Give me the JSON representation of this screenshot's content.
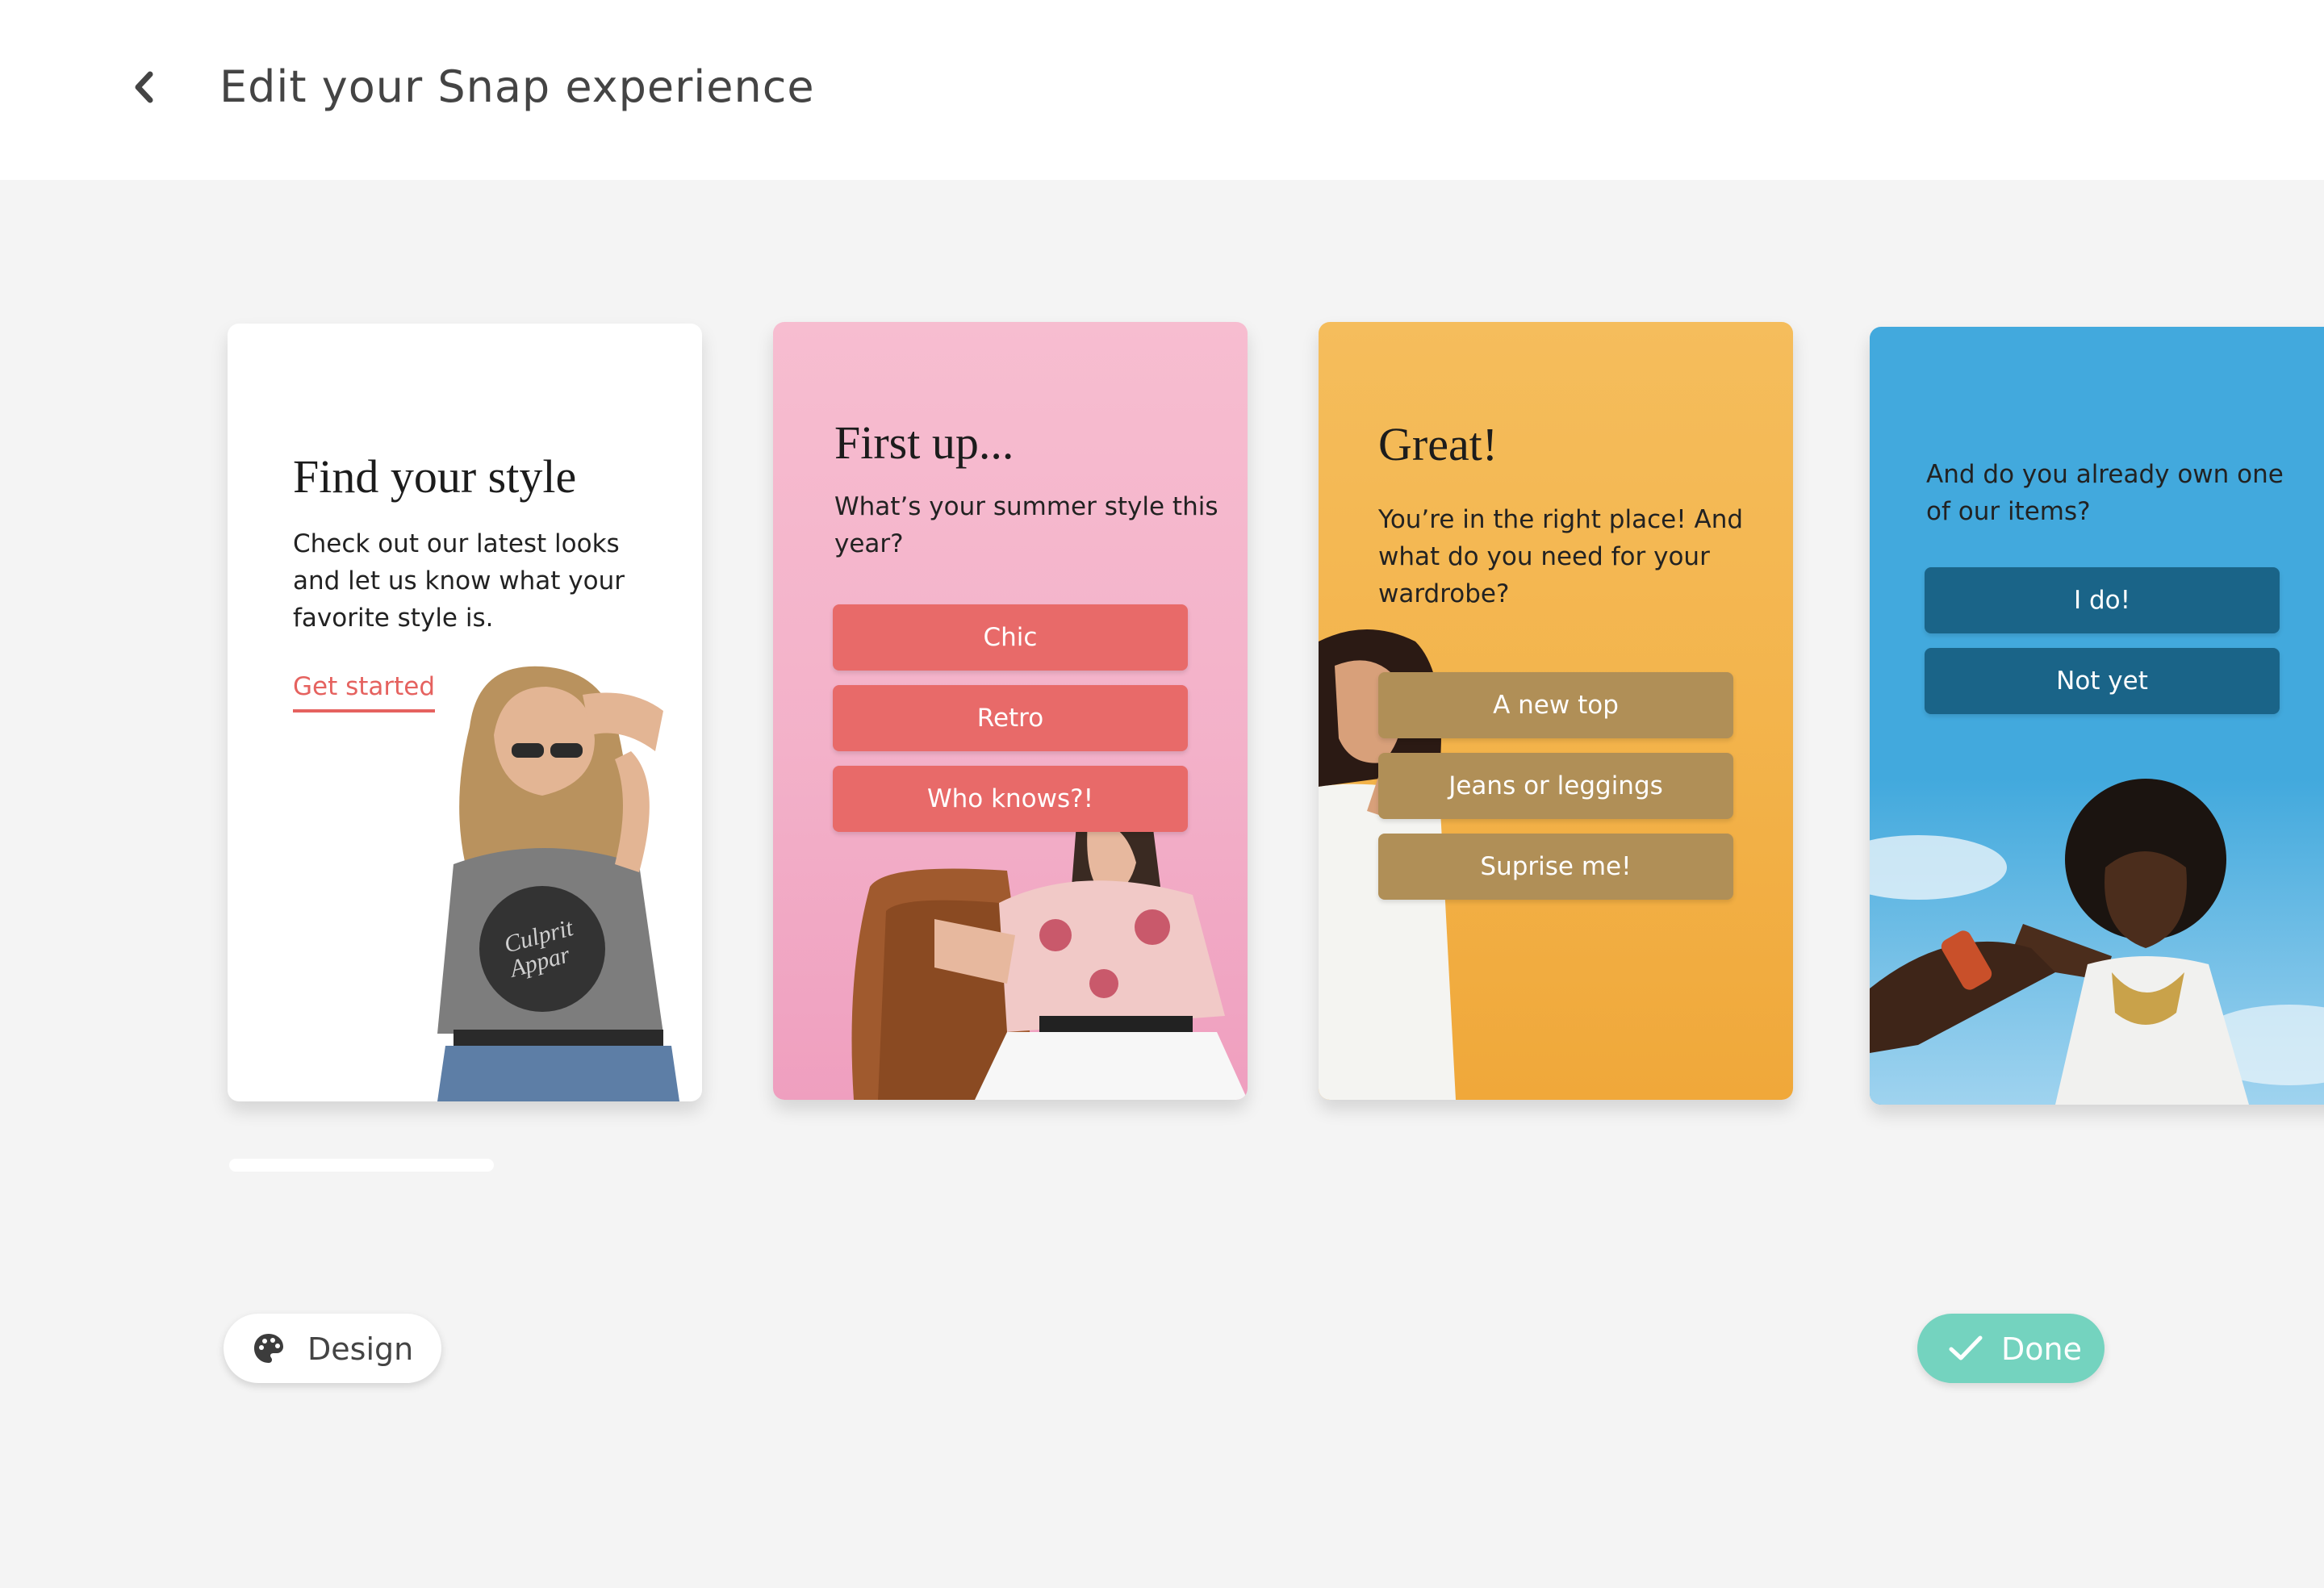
{
  "header": {
    "title": "Edit your Snap experience",
    "back_icon": "chevron-left-icon"
  },
  "cards": [
    {
      "title": "Find your style",
      "body": [
        "Check out our latest looks",
        "and let us know what your",
        "favorite style is."
      ],
      "link": "Get started",
      "shirt_text": [
        "Culprit",
        "Appar"
      ],
      "background": "#ffffff",
      "accent": "#e5625f"
    },
    {
      "title": "First up...",
      "body": [
        "What’s your summer style this",
        "year?"
      ],
      "options": [
        "Chic",
        "Retro",
        "Who knows?!"
      ],
      "background": "#f5b8cd",
      "button_color": "#e86a69"
    },
    {
      "title": "Great!",
      "body": [
        "You’re in the right place! And",
        "what do you need for your",
        "wardrobe?"
      ],
      "options": [
        "A new top",
        "Jeans or leggings",
        "Suprise me!"
      ],
      "background": "#f3b44c",
      "button_color": "#b08f57"
    },
    {
      "body": [
        "And do you already own one",
        "of our items?"
      ],
      "options": [
        "I do!",
        "Not yet"
      ],
      "background": "#42a9dd",
      "button_color": "#1a6488"
    }
  ],
  "footer": {
    "design_label": "Design",
    "design_icon": "palette-icon",
    "done_label": "Done",
    "done_icon": "check-icon",
    "done_color": "#74d3bf"
  }
}
